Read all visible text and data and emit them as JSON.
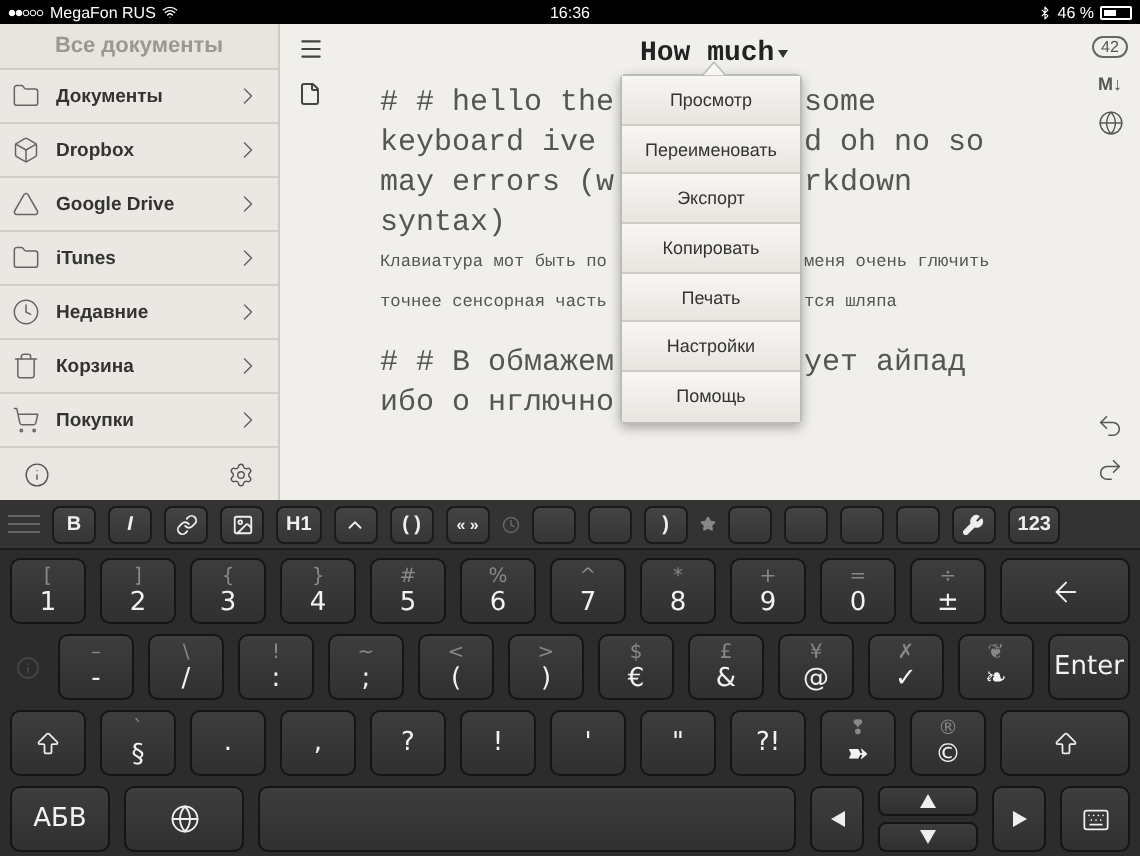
{
  "status_bar": {
    "carrier": "MegaFon RUS",
    "time": "16:36",
    "battery": "46 %"
  },
  "sidebar": {
    "title": "Все документы",
    "items": [
      {
        "label": "Документы",
        "kind": "folder"
      },
      {
        "label": "Dropbox",
        "kind": "dropbox"
      },
      {
        "label": "Google Drive",
        "kind": "drive"
      },
      {
        "label": "iTunes",
        "kind": "folder"
      },
      {
        "label": "Недавние",
        "kind": "recent"
      },
      {
        "label": "Корзина",
        "kind": "trash"
      },
      {
        "label": "Покупки",
        "kind": "purchases"
      }
    ]
  },
  "editor": {
    "title": "How much",
    "word_count": "42",
    "markdown_label": "M↓",
    "lines": [
      {
        "kind": "heading",
        "left": "# # hello the",
        "right": "some"
      },
      {
        "kind": "heading",
        "left": "keyboard ive",
        "right": "d oh no so"
      },
      {
        "kind": "heading",
        "left": "may errors (w",
        "right": "rkdown"
      },
      {
        "kind": "heading",
        "left": "syntax)"
      },
      {
        "kind": "body",
        "left": "Клавиатура мот быть по",
        "right": "меня очень глючить"
      },
      {
        "kind": "body",
        "left": "точнее сенсорная часть",
        "right": "тся шляпа"
      },
      {
        "kind": "spacer"
      },
      {
        "kind": "heading",
        "left": "# # В обмажем",
        "right": "ует айпад"
      },
      {
        "kind": "heading",
        "left": "ибо о нглючно"
      }
    ]
  },
  "menu": {
    "items": [
      "Просмотр",
      "Переименовать",
      "Экспорт",
      "Копировать",
      "Печать",
      "Настройки",
      "Помощь"
    ]
  },
  "keyboard": {
    "toolbar": [
      {
        "kind": "grip"
      },
      {
        "kind": "text",
        "label": "B"
      },
      {
        "kind": "italic",
        "label": "I"
      },
      {
        "kind": "link"
      },
      {
        "kind": "image"
      },
      {
        "kind": "text",
        "label": "H1"
      },
      {
        "kind": "caret"
      },
      {
        "kind": "text",
        "label": "( )"
      },
      {
        "kind": "small",
        "label": "« »"
      },
      {
        "kind": "clock"
      },
      {
        "kind": "blank"
      },
      {
        "kind": "blank"
      },
      {
        "kind": "text",
        "label": ")"
      },
      {
        "kind": "star"
      },
      {
        "kind": "blank"
      },
      {
        "kind": "blank"
      },
      {
        "kind": "blank"
      },
      {
        "kind": "blank"
      },
      {
        "kind": "wrench"
      },
      {
        "kind": "text",
        "label": "123"
      }
    ],
    "rows": [
      [
        {
          "kind": "char",
          "top": "[",
          "main": "1"
        },
        {
          "kind": "char",
          "top": "]",
          "main": "2"
        },
        {
          "kind": "char",
          "top": "{",
          "main": "3"
        },
        {
          "kind": "char",
          "top": "}",
          "main": "4"
        },
        {
          "kind": "char",
          "top": "#",
          "main": "5"
        },
        {
          "kind": "char",
          "top": "%",
          "main": "6"
        },
        {
          "kind": "char",
          "top": "^",
          "main": "7"
        },
        {
          "kind": "char",
          "top": "*",
          "main": "8"
        },
        {
          "kind": "char",
          "top": "+",
          "main": "9"
        },
        {
          "kind": "char",
          "top": "=",
          "main": "0"
        },
        {
          "kind": "char",
          "top": "÷",
          "main": "±"
        },
        {
          "kind": "backspace"
        }
      ],
      [
        {
          "kind": "info"
        },
        {
          "kind": "char",
          "top": "–",
          "main": "-"
        },
        {
          "kind": "char",
          "top": "\\",
          "main": "/"
        },
        {
          "kind": "char",
          "top": "!",
          "main": ":"
        },
        {
          "kind": "char",
          "top": "~",
          "main": ";"
        },
        {
          "kind": "char",
          "top": "<",
          "main": "("
        },
        {
          "kind": "char",
          "top": ">",
          "main": ")"
        },
        {
          "kind": "char",
          "top": "$",
          "main": "€"
        },
        {
          "kind": "char",
          "top": "£",
          "main": "&"
        },
        {
          "kind": "char",
          "top": "¥",
          "main": "@"
        },
        {
          "kind": "char",
          "top": "✗",
          "main": "✓"
        },
        {
          "kind": "char",
          "top": "❦",
          "main": "❧"
        },
        {
          "kind": "label",
          "main": "Enter"
        }
      ],
      [
        {
          "kind": "shift"
        },
        {
          "kind": "char",
          "top": "`",
          "main": "§"
        },
        {
          "kind": "char",
          "main": "."
        },
        {
          "kind": "char",
          "main": ","
        },
        {
          "kind": "char",
          "main": "?"
        },
        {
          "kind": "char",
          "main": "!"
        },
        {
          "kind": "char",
          "main": "'"
        },
        {
          "kind": "char",
          "main": "\""
        },
        {
          "kind": "char",
          "main": "?!"
        },
        {
          "kind": "char",
          "top": "❢",
          "main": "➽"
        },
        {
          "kind": "char",
          "top": "®",
          "main": "©"
        },
        {
          "kind": "shift-wide"
        }
      ],
      [
        {
          "kind": "label",
          "main": "АБВ"
        },
        {
          "kind": "globe"
        },
        {
          "kind": "space"
        },
        {
          "kind": "left"
        },
        {
          "kind": "updown"
        },
        {
          "kind": "right"
        },
        {
          "kind": "hide"
        }
      ]
    ]
  }
}
